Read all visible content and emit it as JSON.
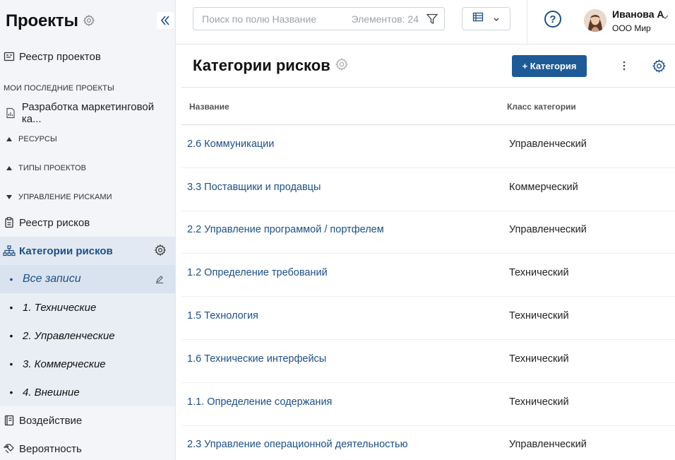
{
  "sidebar": {
    "title": "Проекты",
    "items": {
      "registry": "Реестр проектов",
      "recent_section": "Мои последние проекты",
      "recent_project": "Разработка маркетинговой ка...",
      "resources": "Ресурсы",
      "project_types": "Типы проектов",
      "risk_mgmt": "Управление рисками",
      "risk_registry": "Реестр рисков",
      "risk_categories": "Категории рисков",
      "impact": "Воздействие",
      "probability": "Вероятность"
    },
    "subitems": [
      "Все записи",
      "1. Технические",
      "2. Управленческие",
      "3. Коммерческие",
      "4. Внешние"
    ]
  },
  "topbar": {
    "search_placeholder": "Поиск по полю Название",
    "elements_count": "Элементов: 24",
    "help": "?",
    "user_name": "Иванова А",
    "user_company": "ООО Мир"
  },
  "content": {
    "title": "Категории рисков",
    "add_button": "+ Категория",
    "columns": [
      "Название",
      "Класс категории"
    ],
    "rows": [
      {
        "name": "2.6 Коммуникации",
        "class": "Управленческий"
      },
      {
        "name": "3.3 Поставщики и продавцы",
        "class": "Коммерческий"
      },
      {
        "name": "2.2 Управление программой / портфелем",
        "class": "Управленческий"
      },
      {
        "name": "1.2 Определение требований",
        "class": "Технический"
      },
      {
        "name": "1.5 Технология",
        "class": "Технический"
      },
      {
        "name": "1.6 Технические интерфейсы",
        "class": "Технический"
      },
      {
        "name": "1.1. Определение содержания",
        "class": "Технический"
      },
      {
        "name": "2.3 Управление операционной деятельностью",
        "class": "Управленческий"
      }
    ]
  },
  "colors": {
    "accent": "#1e4f86",
    "button": "#1e5a96",
    "sidebar_bg": "#f3f5f8"
  }
}
